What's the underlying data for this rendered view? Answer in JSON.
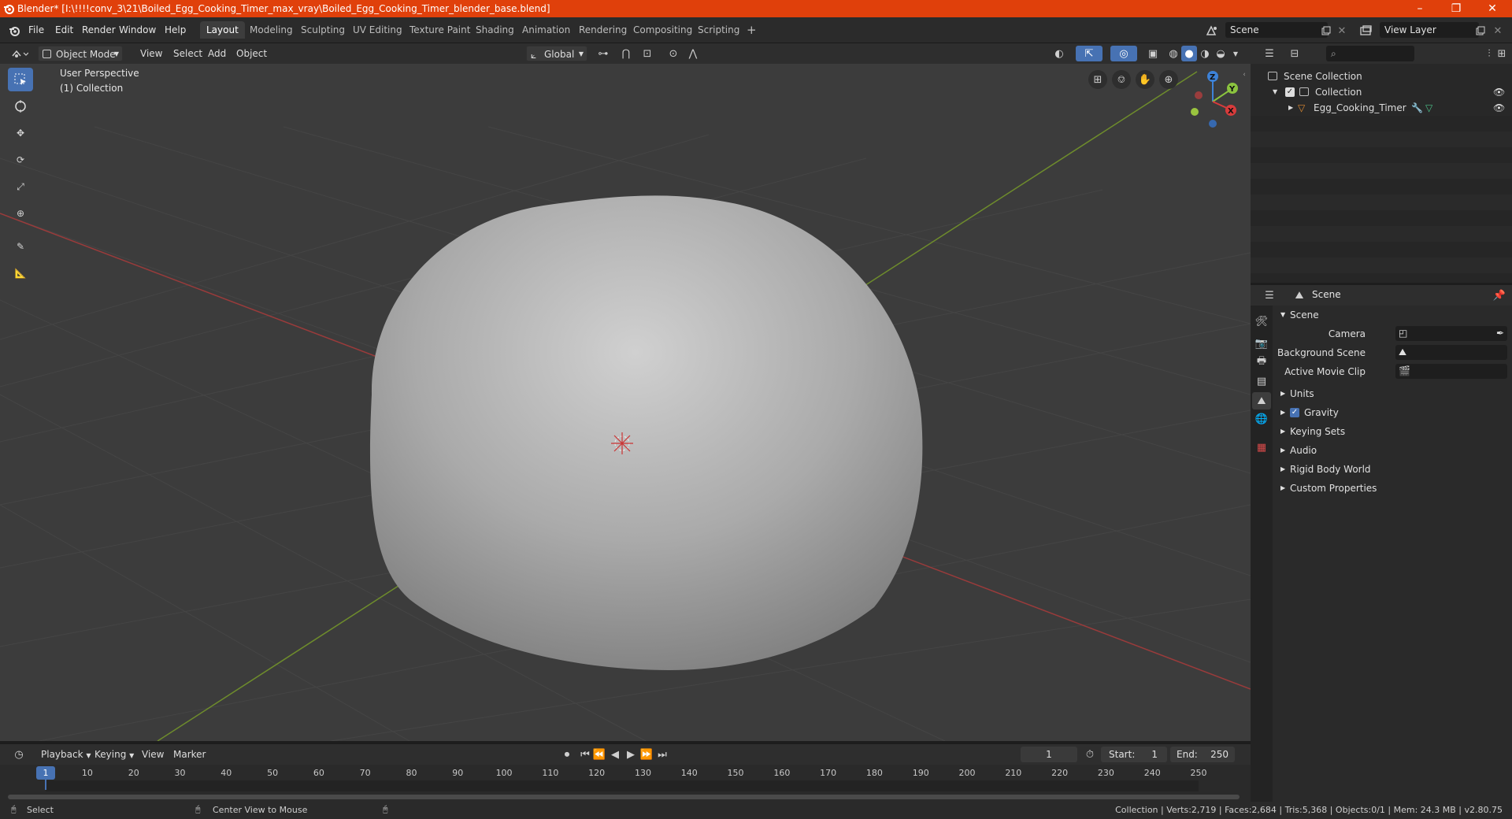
{
  "window": {
    "title": "Blender* [I:\\!!!!conv_3\\21\\Boiled_Egg_Cooking_Timer_max_vray\\Boiled_Egg_Cooking_Timer_blender_base.blend]",
    "minimize": "–",
    "maximize": "❐",
    "close": "✕"
  },
  "menu": [
    "File",
    "Edit",
    "Render",
    "Window",
    "Help"
  ],
  "workspaces": [
    "Layout",
    "Modeling",
    "Sculpting",
    "UV Editing",
    "Texture Paint",
    "Shading",
    "Animation",
    "Rendering",
    "Compositing",
    "Scripting"
  ],
  "workspace_add": "+",
  "scene_field": "Scene",
  "view_layer_field": "View Layer",
  "viewport_header": {
    "mode": "Object Mode",
    "menus": [
      "View",
      "Select",
      "Add",
      "Object"
    ],
    "orientation": "Global"
  },
  "viewport_info": {
    "line1": "User Perspective",
    "line2": "(1) Collection"
  },
  "gizmo": {
    "z": "Z",
    "y": "Y",
    "x": "X"
  },
  "outliner": {
    "search_placeholder": "",
    "root": "Scene Collection",
    "collection": "Collection",
    "object": "Egg_Cooking_Timer"
  },
  "properties": {
    "header_title": "Scene",
    "section": "Scene",
    "camera_label": "Camera",
    "background_scene_label": "Background Scene",
    "active_movie_clip_label": "Active Movie Clip",
    "panels": [
      "Units",
      "Gravity",
      "Keying Sets",
      "Audio",
      "Rigid Body World",
      "Custom Properties"
    ],
    "gravity_checked": true
  },
  "timeline": {
    "menus": [
      "Playback",
      "Keying",
      "View",
      "Marker"
    ],
    "current_frame": "1",
    "start_label": "Start:",
    "start": "1",
    "end_label": "End:",
    "end": "250",
    "ticks": [
      "1",
      "10",
      "20",
      "30",
      "40",
      "50",
      "60",
      "70",
      "80",
      "90",
      "100",
      "110",
      "120",
      "130",
      "140",
      "150",
      "160",
      "170",
      "180",
      "190",
      "200",
      "210",
      "220",
      "230",
      "240",
      "250"
    ]
  },
  "statusbar": {
    "select": "Select",
    "center_view": "Center View to Mouse",
    "stats": "Collection | Verts:2,719 | Faces:2,684 | Tris:5,368 | Objects:0/1 | Mem: 24.3 MB | v2.80.75"
  },
  "colors": {
    "titlebar": "#e0400b",
    "accent": "#4772b3",
    "x_axis": "#d83b3b",
    "y_axis": "#8bc43f",
    "z_axis": "#3d82d8"
  }
}
